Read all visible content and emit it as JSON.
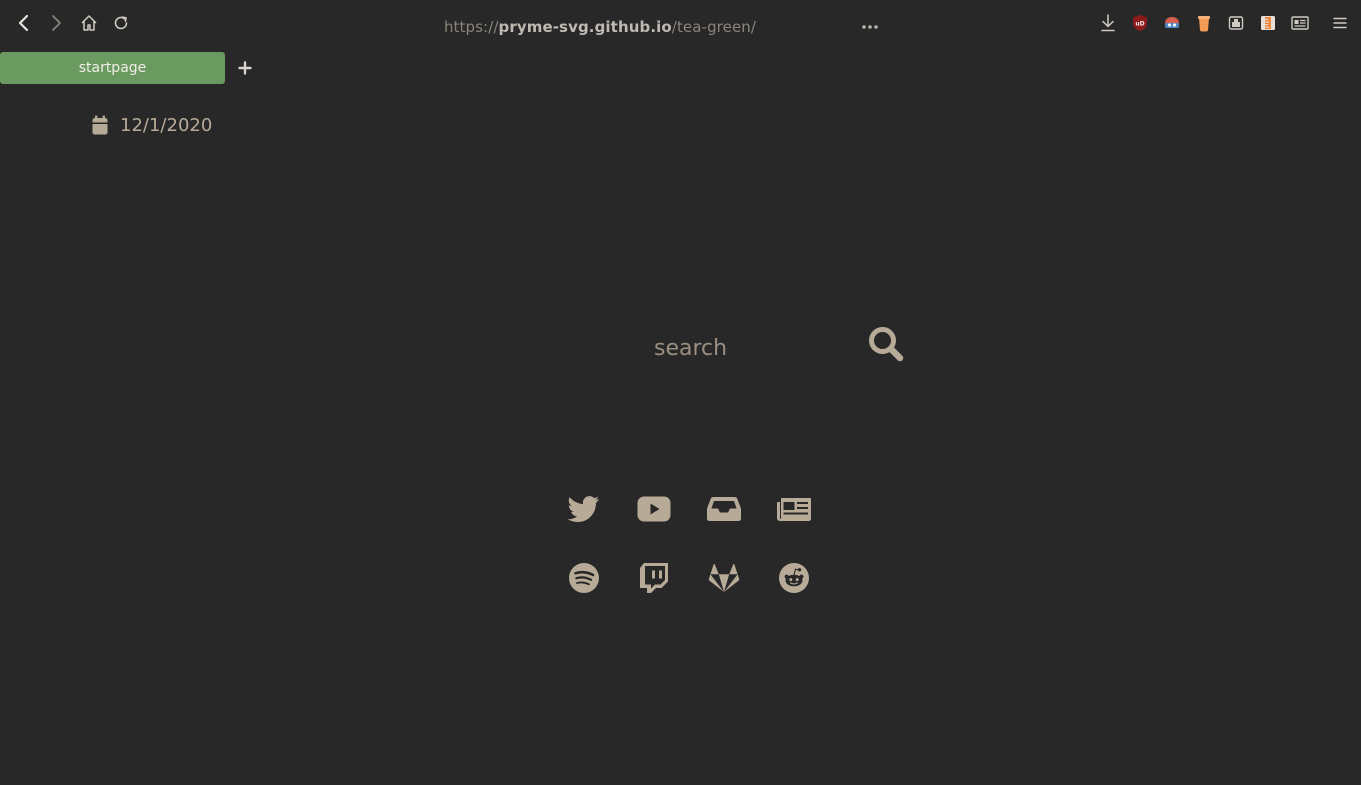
{
  "browser": {
    "url_scheme": "https://",
    "url_host": "pryme-svg.github.io",
    "url_path": "/tea-green/",
    "page_actions_icon": "ellipsis-icon",
    "nav_icons": [
      "back-arrow-icon",
      "forward-arrow-icon",
      "home-icon",
      "reload-icon"
    ],
    "extension_icons": [
      "download-icon",
      "ublock-icon",
      "privacy-badger-icon",
      "honey-icon",
      "container-icon",
      "ruler-icon",
      "reader-view-icon",
      "hamburger-menu-icon"
    ]
  },
  "tabs": [
    {
      "label": "startpage"
    }
  ],
  "new_tab_icon": "plus-icon",
  "date": {
    "icon": "calendar-icon",
    "text": "12/1/2020"
  },
  "search": {
    "placeholder": "search",
    "value": "",
    "icon": "search-icon"
  },
  "links": [
    {
      "icon": "twitter-icon"
    },
    {
      "icon": "youtube-icon"
    },
    {
      "icon": "inbox-icon"
    },
    {
      "icon": "newspaper-icon"
    },
    {
      "icon": "spotify-icon"
    },
    {
      "icon": "twitch-icon"
    },
    {
      "icon": "gitlab-icon"
    },
    {
      "icon": "reddit-icon"
    }
  ],
  "colors": {
    "background": "#282828",
    "accent_tab": "#6a9a5f",
    "icon": "#b7ab98",
    "text": "#b7ab98"
  }
}
